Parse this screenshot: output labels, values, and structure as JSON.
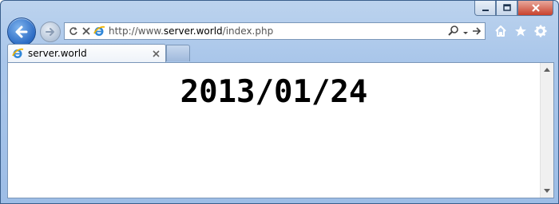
{
  "browser": {
    "address": {
      "prefix": "http://www.",
      "host": "server.world",
      "path": "/index.php"
    },
    "tab": {
      "label": "server.world"
    }
  },
  "page": {
    "date": "2013/01/24"
  },
  "colors": {
    "accent": "#2b6bc4",
    "close": "#c8412c"
  },
  "icons": [
    "back-arrow-icon",
    "forward-arrow-icon",
    "refresh-icon",
    "stop-icon",
    "ie-icon",
    "search-icon",
    "go-arrow-icon",
    "home-icon",
    "favorites-star-icon",
    "gear-icon",
    "close-icon"
  ]
}
